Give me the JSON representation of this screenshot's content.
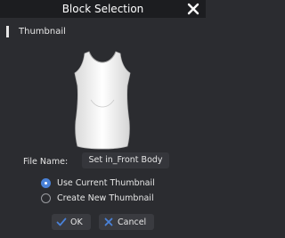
{
  "window": {
    "title": "Block Selection"
  },
  "section": {
    "label": "Thumbnail"
  },
  "thumbnail": {
    "subject": "sleeveless-top-icon"
  },
  "file_name": {
    "label": "File Name:",
    "value": "Set in_Front Body"
  },
  "options": [
    {
      "label": "Use Current Thumbnail",
      "selected": true
    },
    {
      "label": "Create New Thumbnail",
      "selected": false
    }
  ],
  "buttons": {
    "ok": "OK",
    "cancel": "Cancel"
  },
  "colors": {
    "accent": "#4a82d8",
    "background": "#2b2c30",
    "titlebar": "#1c1d20"
  }
}
